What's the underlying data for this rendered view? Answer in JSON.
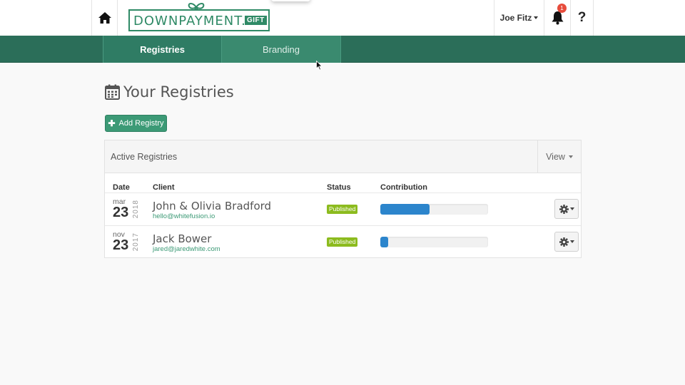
{
  "header": {
    "logo": {
      "text": "DOWNPAYMENT.",
      "badge": "GIFT"
    },
    "user_name": "Joe Fitz",
    "notifications_count": "1",
    "help_label": "?"
  },
  "nav": {
    "tabs": [
      {
        "label": "Registries",
        "active": true
      },
      {
        "label": "Branding",
        "active": false
      }
    ]
  },
  "main": {
    "title": "Your Registries",
    "add_button_label": "Add Registry",
    "panel": {
      "title": "Active Registries",
      "view_label": "View",
      "columns": [
        "Date",
        "Client",
        "Status",
        "Contribution"
      ],
      "rows": [
        {
          "month": "mar",
          "day": "23",
          "year": "2018",
          "client": "John & Olivia Bradford",
          "email": "hello@whitefusion.io",
          "status": "Published",
          "contribution": 0.46
        },
        {
          "month": "nov",
          "day": "23",
          "year": "2017",
          "client": "Jack Bower",
          "email": "jared@jaredwhite.com",
          "status": "Published",
          "contribution": 0.07
        }
      ]
    }
  },
  "colors": {
    "brand": "#2f8a66",
    "nav": "#2b6e59",
    "status": "#8cbb1e",
    "progress": "#2c85cc",
    "badge": "#e74c3c"
  },
  "icons": [
    "home-icon",
    "bell-icon",
    "calendar-icon",
    "plus-icon",
    "gear-icon",
    "caret-down-icon",
    "cursor-icon"
  ]
}
